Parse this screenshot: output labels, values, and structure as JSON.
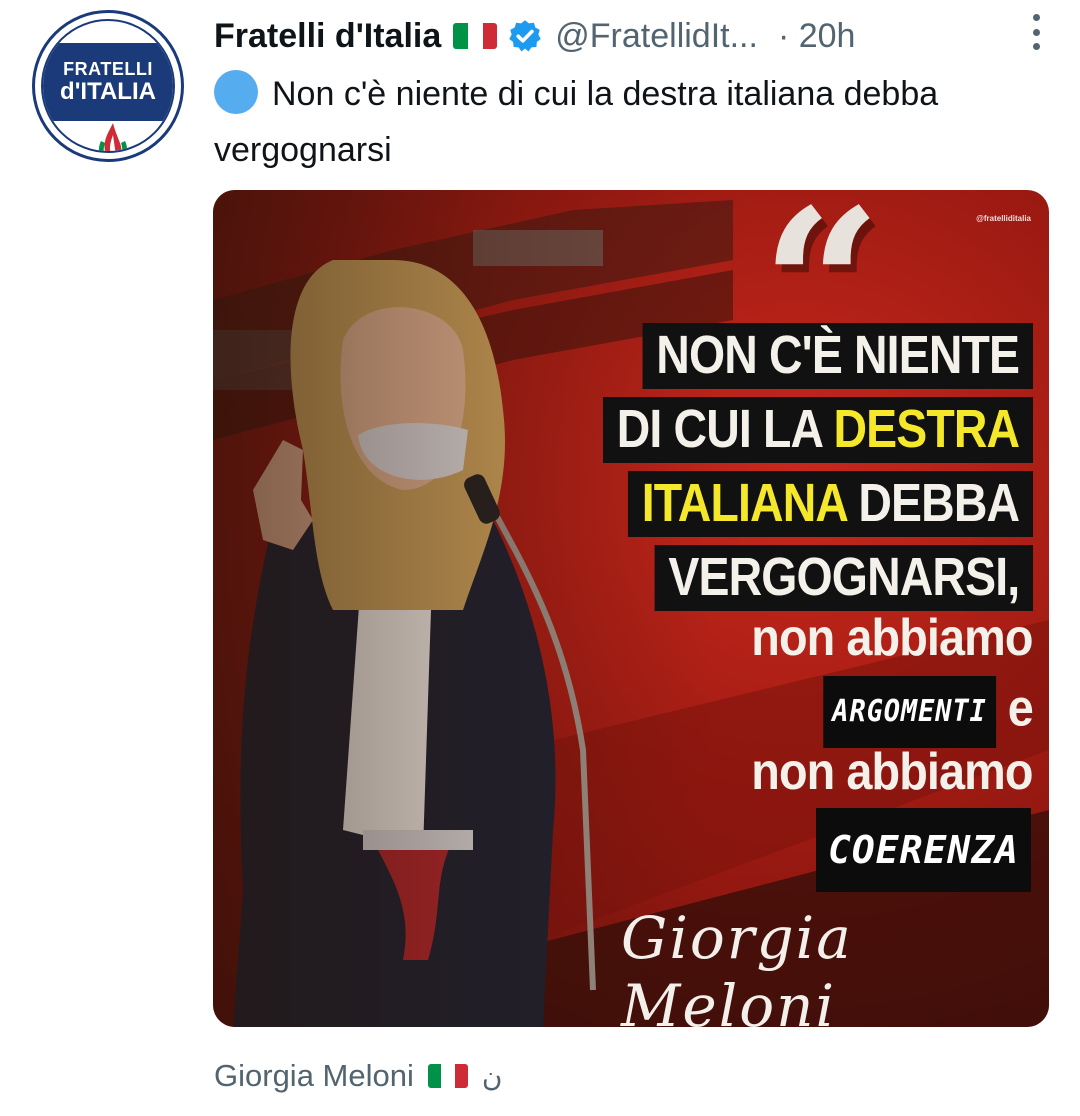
{
  "account": {
    "avatar_text_line1": "FRATELLI",
    "avatar_text_line2": "d'ITALIA",
    "display_name": "Fratelli d'Italia",
    "flag_icon": "italian-flag-icon",
    "verified_icon": "verified-badge-icon",
    "handle": "@FratellidIt...",
    "time": "· 20h",
    "more_icon": "more-options-icon"
  },
  "tweet": {
    "bullet_icon": "blue-circle-icon",
    "text": "Non c'è niente di cui la destra italiana debba vergognarsi"
  },
  "media": {
    "watermark": "@fratelliditalia",
    "quote_mark": "“",
    "lines": [
      [
        "NON C'È NIENTE"
      ],
      [
        "DI CUI LA ",
        "DESTRA"
      ],
      [
        "ITALIANA",
        " DEBBA"
      ],
      [
        "VERGOGNARSI,"
      ],
      [
        "non abbiamo"
      ],
      [
        "ARGOMENTI",
        " e"
      ],
      [
        "non abbiamo"
      ],
      [
        "COERENZA"
      ]
    ],
    "signature": "Giorgia Meloni"
  },
  "footer": {
    "name": "Giorgia Meloni",
    "flag_icon": "italian-flag-icon",
    "extra": "ن"
  },
  "colors": {
    "text_primary": "#0f1419",
    "text_secondary": "#536471",
    "verified_blue": "#1d9bf0",
    "highlight_yellow": "#f5e82a",
    "media_red": "#b3201a",
    "flag_green": "#009246",
    "flag_white": "#ffffff",
    "flag_red": "#ce2b37"
  }
}
